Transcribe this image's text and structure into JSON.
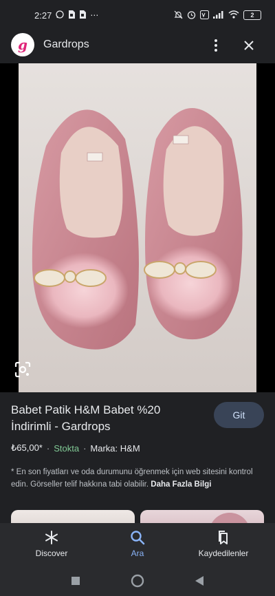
{
  "status_bar": {
    "time": "2:27",
    "battery": "2",
    "left_icons": [
      "whatsapp-icon",
      "sim-icon",
      "sim-icon",
      "more-notifications-icon"
    ],
    "right_icons": [
      "mute-icon",
      "alarm-icon",
      "vowifi-icon",
      "signal-icon",
      "wifi-icon",
      "battery-icon"
    ]
  },
  "header": {
    "app_name": "Gardrops",
    "logo_letter": "g"
  },
  "product": {
    "title": "Babet Patik H&M Babet %20 İndirimli - Gardrops",
    "price": "₺65,00*",
    "stock": "Stokta",
    "brand": "Marka: H&M",
    "disclaimer": "* En son fiyatları ve oda durumunu öğrenmek için web sitesini kontrol edin. Görseller telif hakkına tabi olabilir.",
    "more_link": "Daha Fazla Bilgi",
    "go_button": "Git"
  },
  "bottom_nav": [
    {
      "label": "Discover",
      "icon": "asterisk-icon"
    },
    {
      "label": "Ara",
      "icon": "search-icon",
      "active": true
    },
    {
      "label": "Kaydedilenler",
      "icon": "saved-icon"
    }
  ],
  "colors": {
    "background": "#202124",
    "accent": "#8ab4f8",
    "stock_green": "#81c995",
    "button_bg": "#394457",
    "logo_pink": "#e0267a"
  }
}
